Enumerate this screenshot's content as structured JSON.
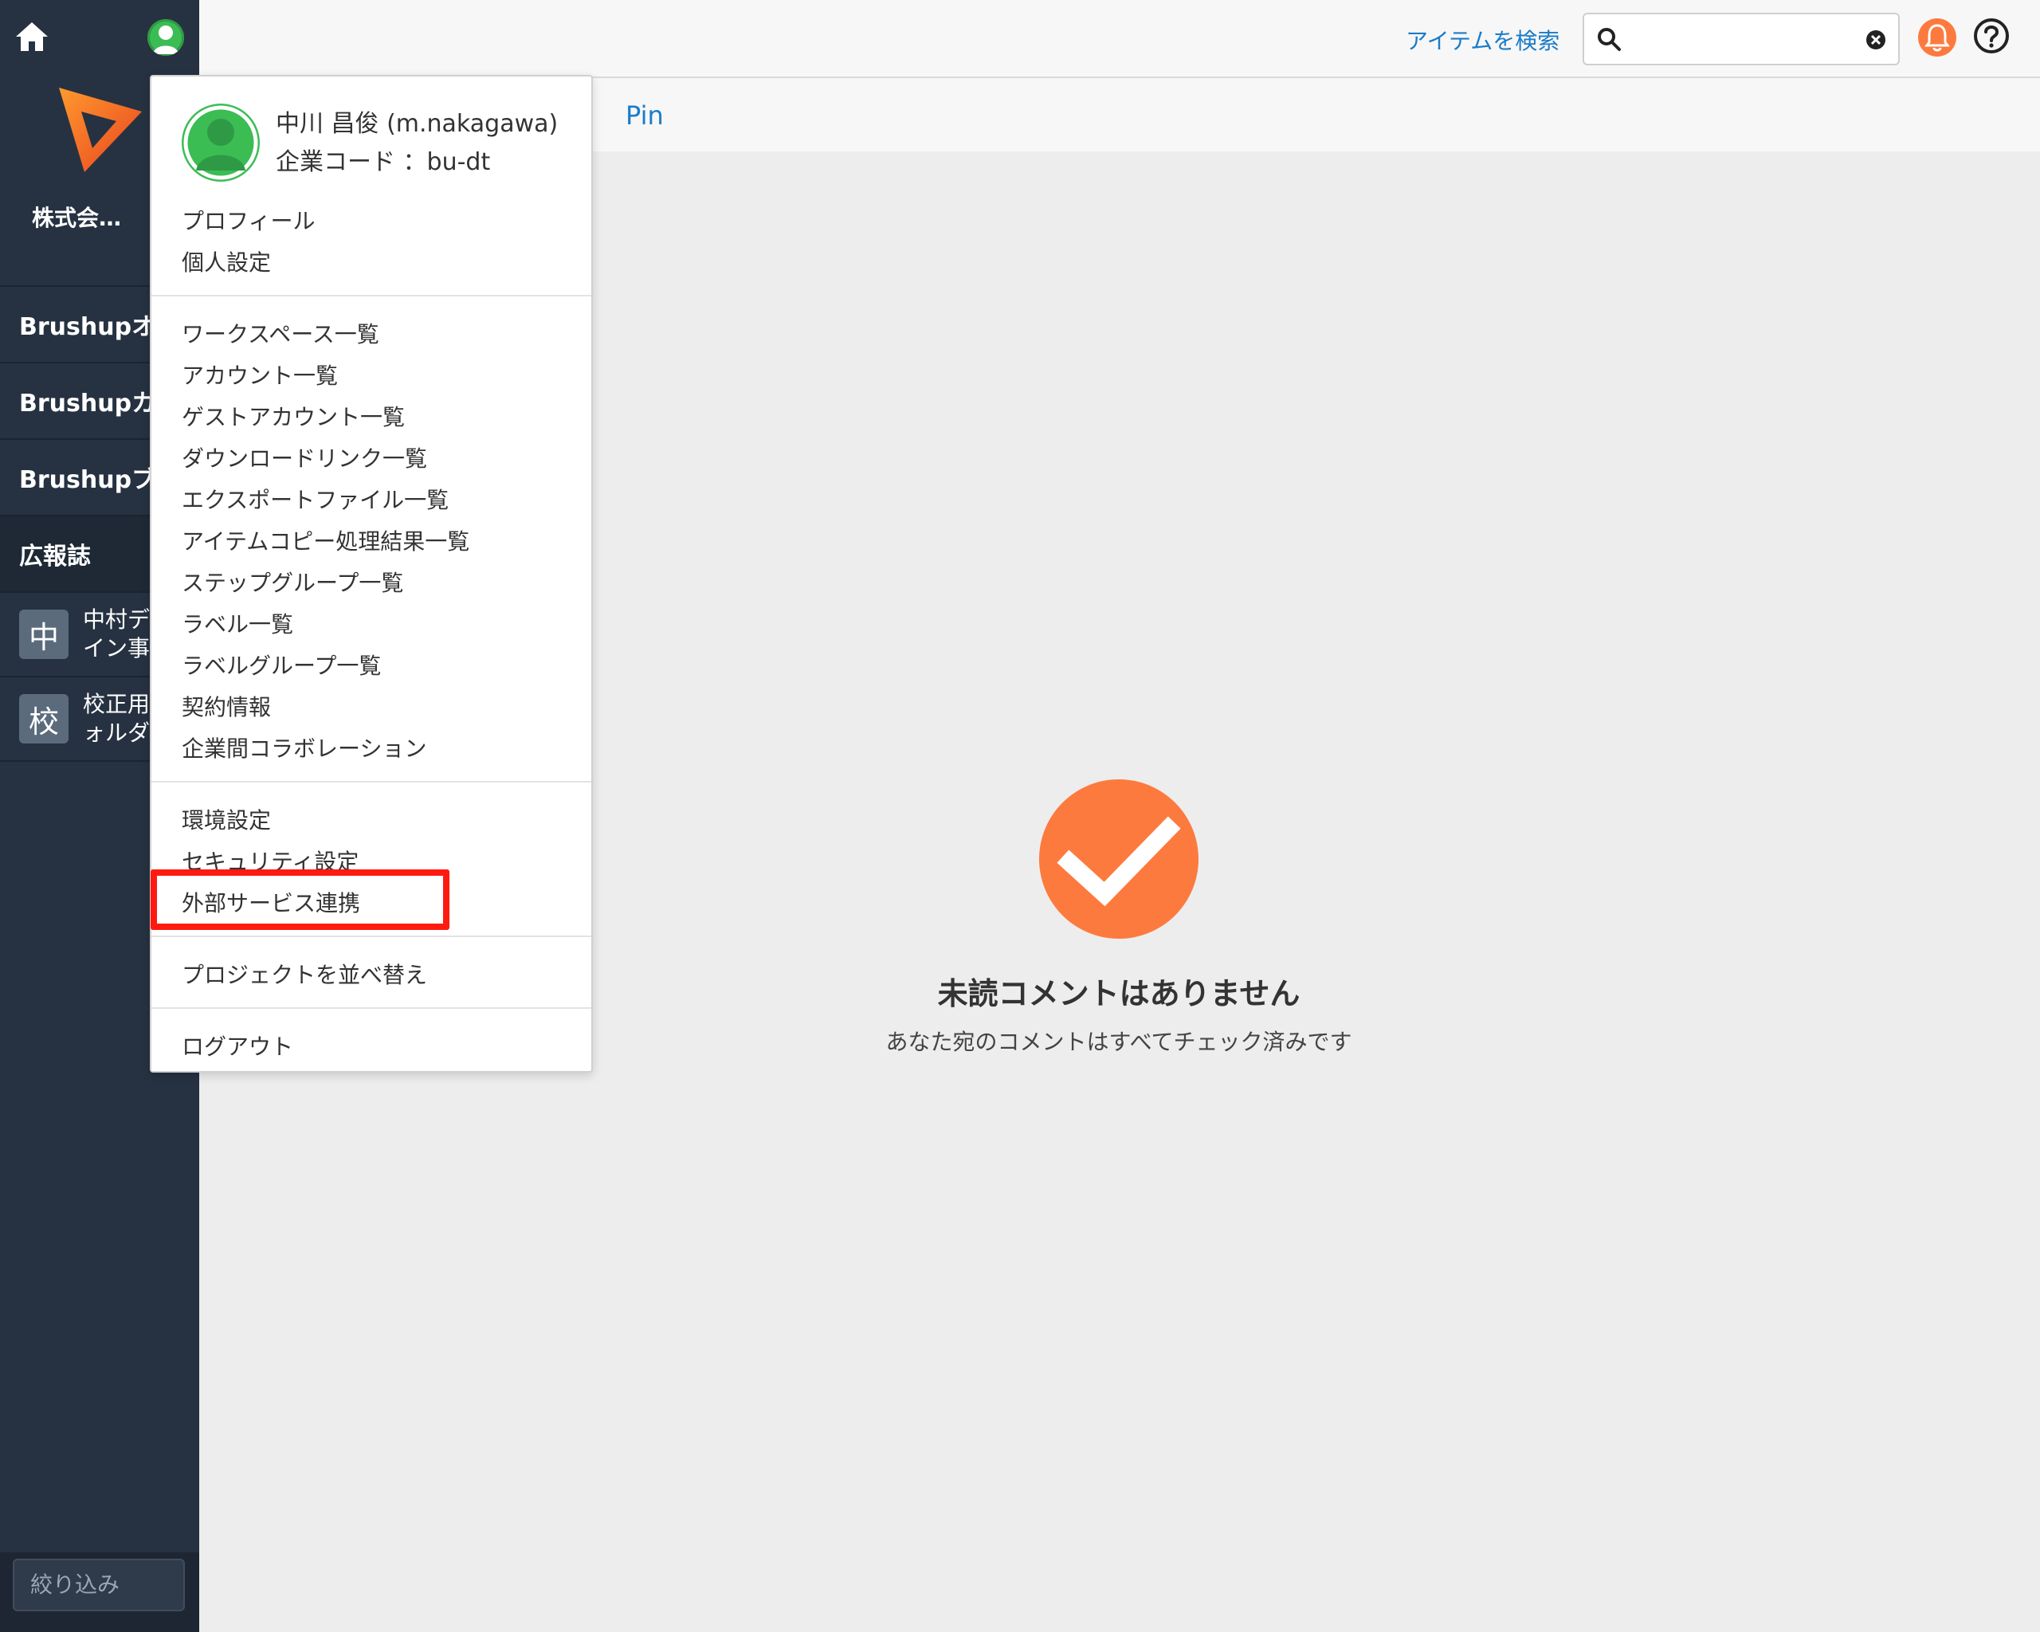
{
  "sidebar": {
    "company": "株式会…",
    "nav": [
      {
        "label": "Brushupオ・"
      },
      {
        "label": "Brushupカ・"
      },
      {
        "label": "Brushupブ・"
      },
      {
        "label": "広報誌"
      }
    ],
    "projects": [
      {
        "badge": "中",
        "line1": "中村デ",
        "line2": "イン事"
      },
      {
        "badge": "校",
        "line1": "校正用",
        "line2": "ォルダ"
      }
    ],
    "filter_placeholder": "絞り込み"
  },
  "header": {
    "search_link": "アイテムを検索",
    "search_value": ""
  },
  "tabs": {
    "pin": "Pin"
  },
  "empty_state": {
    "title": "未読コメントはありません",
    "subtitle": "あなた宛のコメントはすべてチェック済みです"
  },
  "user_menu": {
    "user_name": "中川 昌俊 (m.nakagawa)",
    "company_code": "企業コード ：bu-dt",
    "group1": [
      "プロフィール",
      "個人設定"
    ],
    "group2": [
      "ワークスペース一覧",
      "アカウント一覧",
      "ゲストアカウント一覧",
      "ダウンロードリンク一覧",
      "エクスポートファイル一覧",
      "アイテムコピー処理結果一覧",
      "ステップグループ一覧",
      "ラベル一覧",
      "ラベルグループ一覧",
      "契約情報",
      "企業間コラボレーション"
    ],
    "group3": [
      "環境設定",
      "セキュリティ設定",
      "外部サービス連携"
    ],
    "group4": [
      "プロジェクトを並べ替え"
    ],
    "group5": [
      "ログアウト"
    ]
  },
  "colors": {
    "sidebar": "#263241",
    "accent_orange": "#fd7a3e",
    "link_blue": "#1a7cc9",
    "highlight_red": "#ff1a10",
    "avatar_green": "#3bbd54"
  }
}
